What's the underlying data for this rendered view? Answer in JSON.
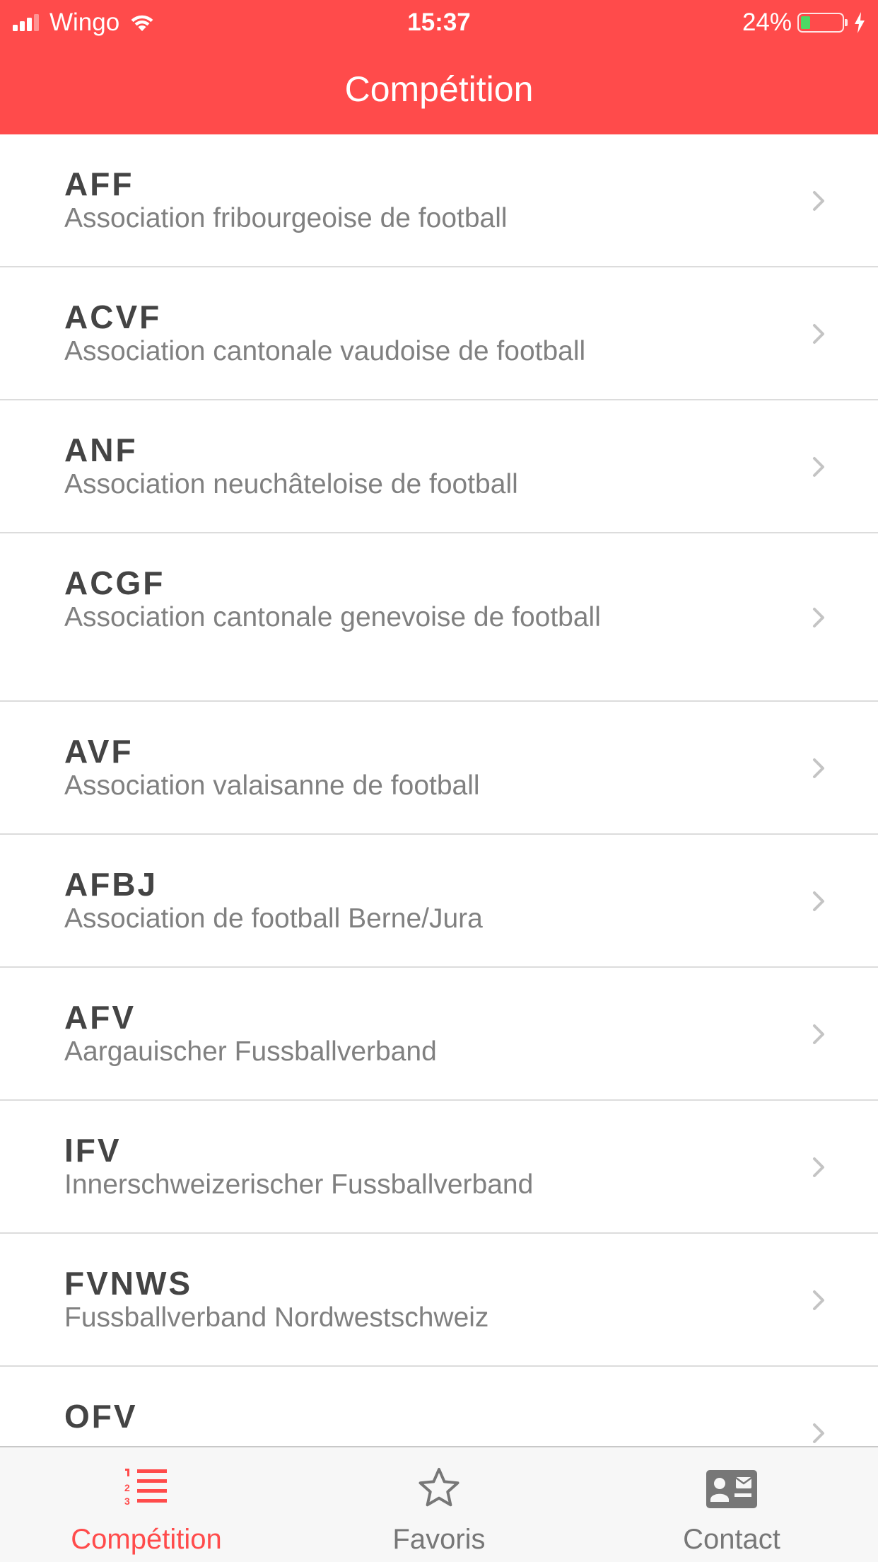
{
  "status_bar": {
    "carrier": "Wingo",
    "time": "15:37",
    "battery_percent": "24%",
    "battery_level": 0.24,
    "signal_bars": 3,
    "signal_total": 4
  },
  "header": {
    "title": "Compétition",
    "color": "#ff4b4b"
  },
  "associations": [
    {
      "code": "AFF",
      "name": "Association fribourgeoise de football"
    },
    {
      "code": "ACVF",
      "name": "Association cantonale vaudoise de football"
    },
    {
      "code": "ANF",
      "name": "Association neuchâteloise de football"
    },
    {
      "code": "ACGF",
      "name": "Association cantonale genevoise de football"
    },
    {
      "code": "AVF",
      "name": "Association valaisanne de football"
    },
    {
      "code": "AFBJ",
      "name": "Association de football Berne/Jura"
    },
    {
      "code": "AFV",
      "name": "Aargauischer Fussballverband"
    },
    {
      "code": "IFV",
      "name": "Innerschweizerischer Fussballverband"
    },
    {
      "code": "FVNWS",
      "name": "Fussballverband Nordwestschweiz"
    },
    {
      "code": "OFV",
      "name": ""
    }
  ],
  "tabbar": {
    "tabs": [
      {
        "label": "Compétition",
        "icon": "numbered-list-icon",
        "active": true
      },
      {
        "label": "Favoris",
        "icon": "star-icon",
        "active": false
      },
      {
        "label": "Contact",
        "icon": "contact-card-icon",
        "active": false
      }
    ],
    "active_color": "#ff4b4b",
    "inactive_color": "#777777"
  }
}
